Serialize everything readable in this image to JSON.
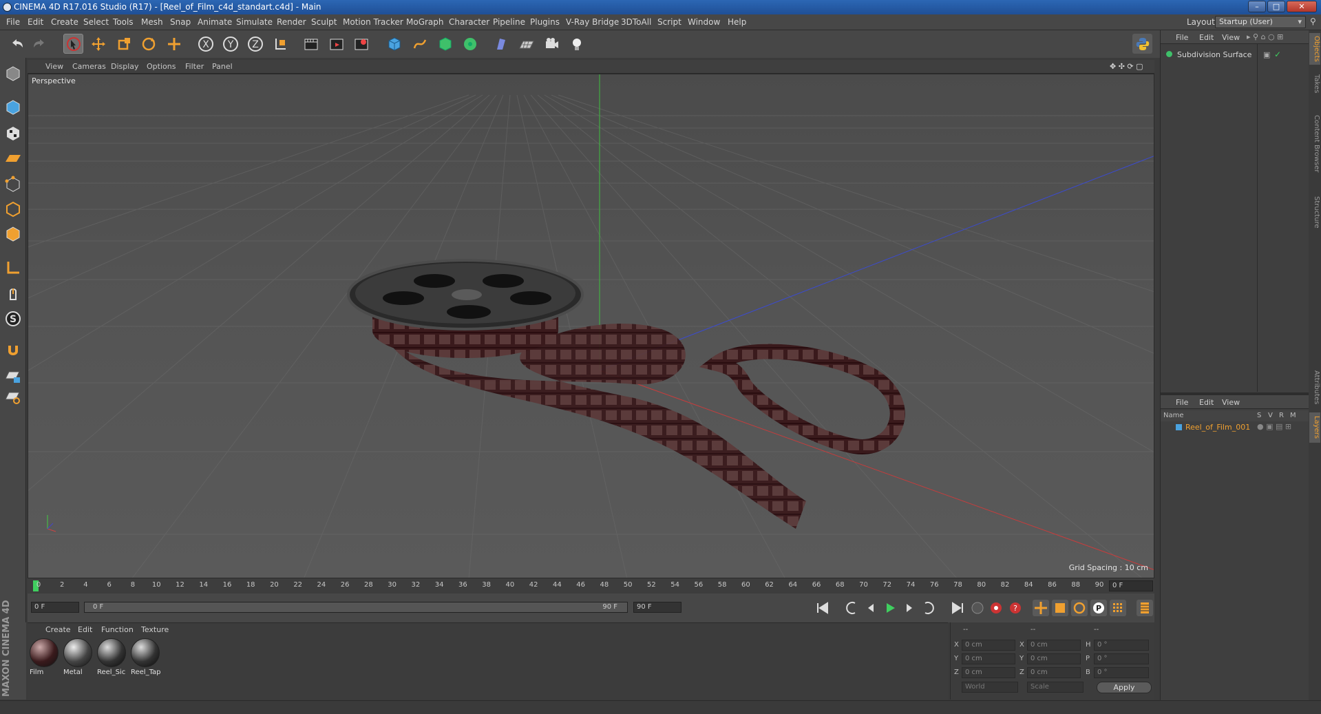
{
  "window": {
    "title": "CINEMA 4D R17.016 Studio (R17) - [Reel_of_Film_c4d_standart.c4d] - Main",
    "minimize": "–",
    "maximize": "□",
    "close": "✕"
  },
  "menubar": {
    "items": [
      "File",
      "Edit",
      "Create",
      "Select",
      "Tools",
      "Mesh",
      "Snap",
      "Animate",
      "Simulate",
      "Render",
      "Sculpt",
      "Motion Tracker",
      "MoGraph",
      "Character",
      "Pipeline",
      "Plugins",
      "V-Ray Bridge",
      "3DToAll",
      "Script",
      "Window",
      "Help"
    ]
  },
  "layout": {
    "label": "Layout:",
    "value": "Startup (User)"
  },
  "viewport": {
    "menu": [
      "View",
      "Cameras",
      "Display",
      "Options",
      "Filter",
      "Panel"
    ],
    "label": "Perspective",
    "grid_spacing": "Grid Spacing : 10 cm"
  },
  "timeline": {
    "ticks": [
      "0",
      "2",
      "4",
      "6",
      "8",
      "10",
      "12",
      "14",
      "16",
      "18",
      "20",
      "22",
      "24",
      "26",
      "28",
      "30",
      "32",
      "34",
      "36",
      "38",
      "40",
      "42",
      "44",
      "46",
      "48",
      "50",
      "52",
      "54",
      "56",
      "58",
      "60",
      "62",
      "64",
      "66",
      "68",
      "70",
      "72",
      "74",
      "76",
      "78",
      "80",
      "82",
      "84",
      "86",
      "88",
      "90"
    ],
    "current_frame": "0 F"
  },
  "transport": {
    "start": "0 F",
    "range_start": "0 F",
    "range_end": "90 F",
    "end": "90 F"
  },
  "materials": {
    "menu": [
      "Create",
      "Edit",
      "Function",
      "Texture"
    ],
    "items": [
      {
        "name": "Film"
      },
      {
        "name": "Metal"
      },
      {
        "name": "Reel_Sic"
      },
      {
        "name": "Reel_Tap"
      }
    ]
  },
  "coords": {
    "rows": [
      {
        "a": "X",
        "av": "0 cm",
        "b": "X",
        "bv": "0 cm",
        "c": "H",
        "cv": "0 °"
      },
      {
        "a": "Y",
        "av": "0 cm",
        "b": "Y",
        "bv": "0 cm",
        "c": "P",
        "cv": "0 °"
      },
      {
        "a": "Z",
        "av": "0 cm",
        "b": "Z",
        "bv": "0 cm",
        "c": "B",
        "cv": "0 °"
      }
    ],
    "header": [
      "--",
      "--",
      "--"
    ],
    "world": "World",
    "scale": "Scale",
    "apply": "Apply"
  },
  "objects": {
    "menu": [
      "File",
      "Edit",
      "View"
    ],
    "item": "Subdivision Surface"
  },
  "layers": {
    "menu": [
      "File",
      "Edit",
      "View"
    ],
    "col_name": "Name",
    "cols": [
      "S",
      "V",
      "R",
      "M"
    ],
    "item": "Reel_of_Film_001"
  },
  "side_tabs": [
    "Objects",
    "Takes",
    "Content Browser",
    "Structure",
    "Attributes",
    "Layers"
  ],
  "brand": {
    "logo_text": "MAXON CINEMA 4D"
  },
  "colors": {
    "accent": "#f0a030",
    "axis_x": "#c44",
    "axis_y": "#4c4",
    "axis_z": "#44c"
  }
}
